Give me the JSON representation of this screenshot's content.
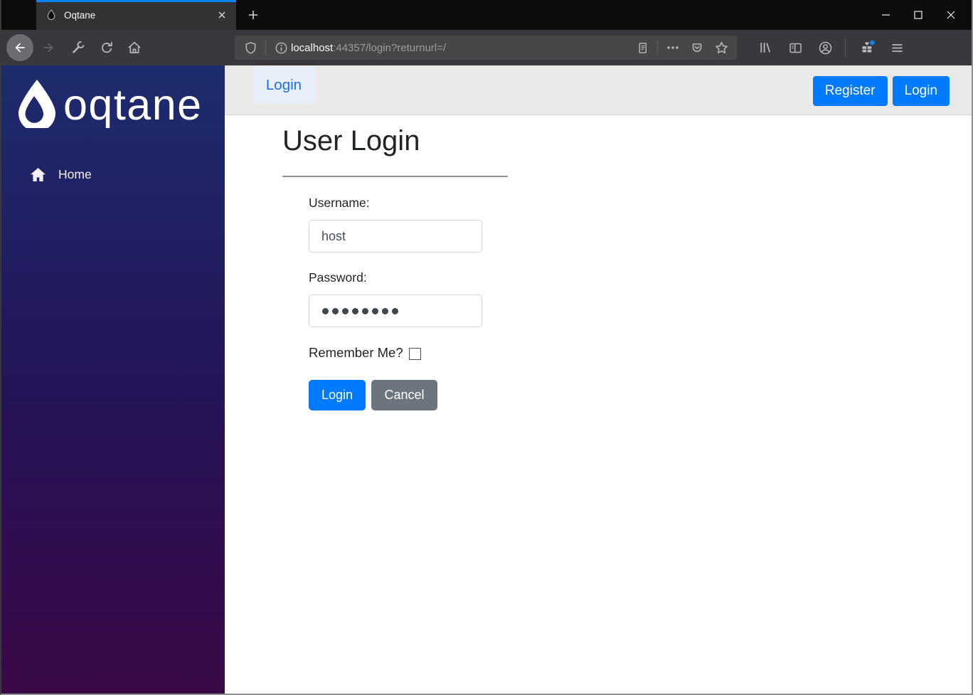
{
  "browser": {
    "tab_title": "Oqtane",
    "url_host": "localhost",
    "url_path": ":44357/login?returnurl=/"
  },
  "sidebar": {
    "brand": "oqtane",
    "items": [
      {
        "label": "Home"
      }
    ]
  },
  "topbar": {
    "nav_login": "Login",
    "register_button": "Register",
    "login_button": "Login"
  },
  "content": {
    "title": "User Login",
    "form": {
      "username_label": "Username:",
      "username_value": "host",
      "password_label": "Password:",
      "password_masked_count": 8,
      "remember_label": "Remember Me?",
      "remember_checked": false,
      "login_button": "Login",
      "cancel_button": "Cancel"
    }
  },
  "colors": {
    "bootstrap_primary": "#007bff",
    "bootstrap_secondary": "#6c757d",
    "firefox_accent": "#0a84ff",
    "sidebar_gradient_top": "#1d2c6e",
    "sidebar_gradient_bottom": "#3a0846"
  }
}
